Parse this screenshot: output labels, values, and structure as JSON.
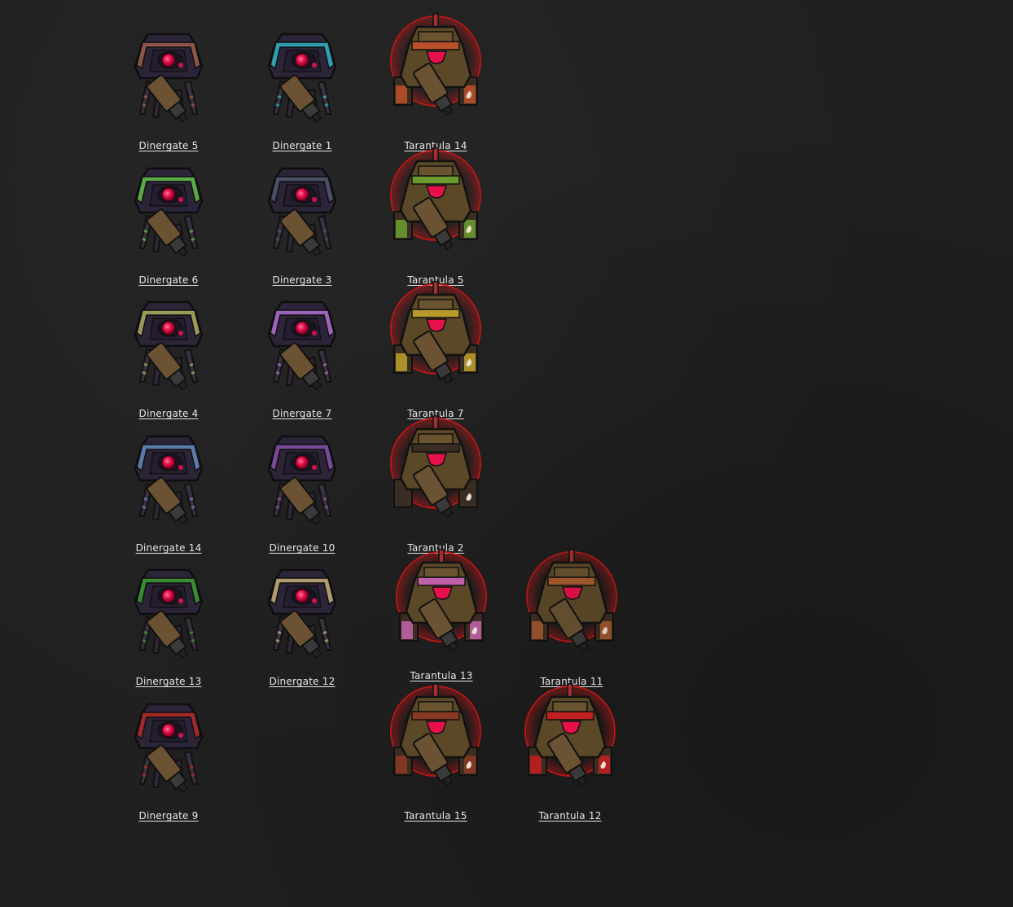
{
  "units": [
    {
      "label": "Dinergate 5",
      "type": "dinergate",
      "accent": "#8c5548"
    },
    {
      "label": "Dinergate 1",
      "type": "dinergate",
      "accent": "#2f9fb0"
    },
    {
      "label": "Tarantula 14",
      "type": "tarantula",
      "accent": "#b8502a"
    },
    {
      "label": "Dinergate 6",
      "type": "dinergate",
      "accent": "#5aa84a"
    },
    {
      "label": "Dinergate 3",
      "type": "dinergate",
      "accent": "#4a4f66"
    },
    {
      "label": "Tarantula 5",
      "type": "tarantula",
      "accent": "#6a9a2e"
    },
    {
      "label": "Dinergate 4",
      "type": "dinergate",
      "accent": "#9a9a5a"
    },
    {
      "label": "Dinergate 7",
      "type": "dinergate",
      "accent": "#9a64b8"
    },
    {
      "label": "Tarantula 7",
      "type": "tarantula",
      "accent": "#b89a2a"
    },
    {
      "label": "Dinergate 14",
      "type": "dinergate",
      "accent": "#5a7aa8"
    },
    {
      "label": "Dinergate 10",
      "type": "dinergate",
      "accent": "#7a4a9a"
    },
    {
      "label": "Tarantula 2",
      "type": "tarantula",
      "accent": "#3a2e24"
    },
    {
      "label": "Dinergate 13",
      "type": "dinergate",
      "accent": "#3a8a32"
    },
    {
      "label": "Dinergate 12",
      "type": "dinergate",
      "accent": "#b09a70"
    },
    {
      "label": "Tarantula 13",
      "type": "tarantula",
      "accent": "#c060a8"
    },
    {
      "label": "Tarantula 11",
      "type": "tarantula",
      "accent": "#a85a2e"
    },
    {
      "label": "Dinergate 9",
      "type": "dinergate",
      "accent": "#a02a2a"
    },
    {
      "label": "Tarantula 15",
      "type": "tarantula",
      "accent": "#8a3a24"
    },
    {
      "label": "Tarantula 12",
      "type": "tarantula",
      "accent": "#c02020"
    }
  ]
}
